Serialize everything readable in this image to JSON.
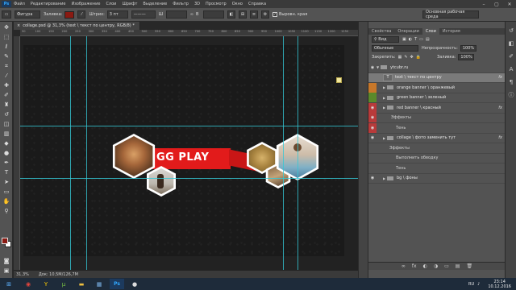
{
  "menu": {
    "logo": "Ps",
    "items": [
      "Файл",
      "Редактирование",
      "Изображение",
      "Слои",
      "Шрифт",
      "Выделение",
      "Фильтр",
      "3D",
      "Просмотр",
      "Окно",
      "Справка"
    ],
    "window_controls": [
      "–",
      "▢",
      "✕"
    ]
  },
  "options_bar": {
    "shape_mode": "Фигура",
    "fill_label": "Заливка:",
    "stroke_label": "Штрих:",
    "stroke_width": "3 пт",
    "align_edges_label": "Выровн. края",
    "align_edges_checked": true,
    "fill_color": "#8a1a12",
    "workspace": "Основная рабочая среда"
  },
  "document": {
    "tab_title": "collage.psd @ 31,3% (text \\ текст по центру, RGB/8) *",
    "ruler_ticks": [
      "50",
      "100",
      "150",
      "200",
      "250",
      "300",
      "350",
      "400",
      "450",
      "500",
      "550",
      "600",
      "650",
      "700",
      "750",
      "800",
      "850",
      "900",
      "950",
      "1000",
      "1050",
      "1100",
      "1150",
      "1200",
      "1250"
    ],
    "zoom": "31,3%",
    "doc_size": "Док: 10,5М/126,7М",
    "banner_text": "GG PLAY",
    "banner_color": "#e21b1b",
    "guide_color": "#35c8d6"
  },
  "panels": {
    "tabs": [
      "Свойства",
      "Операции",
      "Слои",
      "История"
    ],
    "active_tab": "Слои",
    "kind_filter": "Вид",
    "blend_mode": "Обычные",
    "opacity_label": "Непрозрачность:",
    "opacity_value": "100%",
    "lock_label": "Закрепить:",
    "fill_label": "Заливка:",
    "fill_value": "100%",
    "layers": [
      {
        "name": "ytcubr.ru",
        "kind": "group",
        "visible": true
      },
      {
        "name": "text \\ текст по центру",
        "kind": "text",
        "visible": false,
        "selected": true,
        "fx": "fx"
      },
      {
        "name": "orange banner \\ оранжевый",
        "kind": "group",
        "visible": false,
        "tag": "#c8782a"
      },
      {
        "name": "green banner \\ зеленый",
        "kind": "group",
        "visible": false,
        "tag": "#5a8a2a"
      },
      {
        "name": "red banner \\ красный",
        "kind": "group",
        "visible": true,
        "tag": "#b83a3a",
        "fx": "fx"
      },
      {
        "name": "Эффекты",
        "kind": "effects",
        "tag": "#b83a3a"
      },
      {
        "name": "Тень",
        "kind": "effect",
        "tag": "#b83a3a"
      },
      {
        "name": "collage \\ фото заменить тут",
        "kind": "group",
        "visible": true,
        "fx": "fx"
      },
      {
        "name": "Эффекты",
        "kind": "effects"
      },
      {
        "name": "Выполнить обводку",
        "kind": "effect"
      },
      {
        "name": "Тень",
        "kind": "effect"
      },
      {
        "name": "bg \\ фоны",
        "kind": "group",
        "visible": true
      }
    ],
    "footer_icons": [
      "∞",
      "fx",
      "◐",
      "◑",
      "▭",
      "▤",
      "🗑"
    ]
  },
  "taskbar": {
    "apps": [
      {
        "name": "chrome-icon",
        "label": "◉",
        "color": "#e8453c"
      },
      {
        "name": "yandex-icon",
        "label": "Y",
        "color": "#ffcc00"
      },
      {
        "name": "utorrent-icon",
        "label": "µ",
        "color": "#78c043"
      },
      {
        "name": "folder-icon",
        "label": "▬",
        "color": "#f0c040"
      },
      {
        "name": "network-icon",
        "label": "▦",
        "color": "#7cb4e8"
      },
      {
        "name": "photoshop-icon",
        "label": "Ps",
        "color": "#31a8ff"
      },
      {
        "name": "obs-icon",
        "label": "●",
        "color": "#dddddd"
      }
    ],
    "time": "23:14",
    "date": "10.12.2016",
    "language": "RU"
  }
}
